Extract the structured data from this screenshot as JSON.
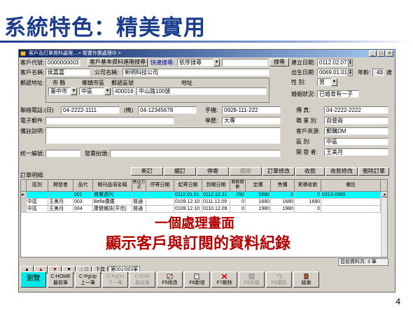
{
  "slide": {
    "title": "系統特色：精美實用",
    "page_number": "4"
  },
  "window": {
    "title": "客戶及訂單資料處理....< 衛豐作業處理中 >",
    "min": "_",
    "max": "□",
    "close": "×"
  },
  "header": {
    "customer_code_label": "客戶代號:",
    "customer_code": "0000000003",
    "advanced_search_button": "客戶基本資料進階搜尋",
    "quick_search_label": "快速搜尋:",
    "quick_search_mode": "依序搜尋",
    "quick_search_value": "",
    "search_button": "搜尋",
    "created_date_label": "建立日期:",
    "created_date": "0112.02.07"
  },
  "customer": {
    "name_label": "客戶名稱:",
    "name": "侯嘉嘉",
    "company_label": "公司名稱:",
    "company": "新明科技公司",
    "birth_label": "出生日期:",
    "birth": "0069.01.01",
    "age_label": "年齡:",
    "age": "43",
    "age_unit": "歲",
    "address_label": "郵遞地址:",
    "city_col": "市 縣",
    "district_col": "鄉鎮市區",
    "zip_col": "郵遞區號",
    "addr_col": "地址",
    "city": "臺中市",
    "district": "中區",
    "zip": "400016",
    "address": "中山路100號",
    "gender_label": "性    別:",
    "gender": "男",
    "marital_label": "婚姻狀況:",
    "marital": "已婚育有一子",
    "phone_label": "聯絡電話:(日)",
    "phone_day": "04-2222-1111",
    "phone_night_label": "(晚)",
    "phone_night": "04-12345678",
    "mobile_label": "手機:",
    "mobile": "0928-111-222",
    "fax_label": "傳    真:",
    "fax": "04-2222-2222",
    "email_label": "電子郵件:",
    "email": "",
    "education_label": "學歷:",
    "education": "大專",
    "job_label": "職 業 別:",
    "job": "自營商",
    "notes_label": "備註說明:",
    "notes": "",
    "source_label": "客戶來源:",
    "source": "郵購DM",
    "region_label": "區    別:",
    "region": "中區",
    "developer_label": "開 發 者:",
    "developer": "王美月",
    "uniform_no_label": "統一編號:",
    "uniform_no": "",
    "invoice_header_label": "發票抬頭:",
    "invoice_header": ""
  },
  "orders": {
    "label": "訂單明細:",
    "buttons": [
      "新訂",
      "續訂",
      "停寄",
      "續寄",
      "訂單修改",
      "收款",
      "收款修改",
      "刪除訂單"
    ],
    "columns": [
      "區別",
      "開發者",
      "品代",
      "期刊品項名稱",
      "寄送方式",
      "停寄日期",
      "起寄日期",
      "到期日期",
      "剩餘期數",
      "定價",
      "售價",
      "累積收款",
      "備註"
    ],
    "rows": [
      [
        "",
        "",
        "001",
        "商業週刊",
        "",
        "",
        "0112.01.01",
        "0112.12.31",
        "290",
        "5990",
        "0",
        "0",
        "0313-0365"
      ],
      [
        "中區",
        "王美月",
        "003",
        "Bella儂儂",
        "普通",
        "",
        "0109.12.10",
        "0111.12.09",
        "0",
        "1680",
        "1680",
        "1680",
        ""
      ],
      [
        "中區",
        "王美月",
        "004",
        "康健雜誌(平信)",
        "普通",
        "",
        "0109.12.10",
        "0110.12.09",
        "0",
        "1980",
        "1980",
        "0",
        ""
      ]
    ],
    "selected_row": 0
  },
  "overlay": {
    "line1": "一個處理畫面",
    "line2": "顯示客戶與訂閱的資料紀錄"
  },
  "navbar": {
    "first": "▲",
    "up": "▲",
    "down": "▼",
    "last": "▼",
    "prev_page": "上頁",
    "next_page": "下頁",
    "page_text": "第001/003筆",
    "status": "目前資料共: 3 筆"
  },
  "footer": {
    "buttons": [
      "瀏覽",
      "C-HOME\n最前筆",
      "C-PgUp\n上一筆",
      "C-PgDn\n下一筆",
      "C-END\n最後筆",
      "F5修改",
      "F6新增",
      "F7刪除",
      "F8存檔",
      "F9還原",
      "結束"
    ]
  }
}
